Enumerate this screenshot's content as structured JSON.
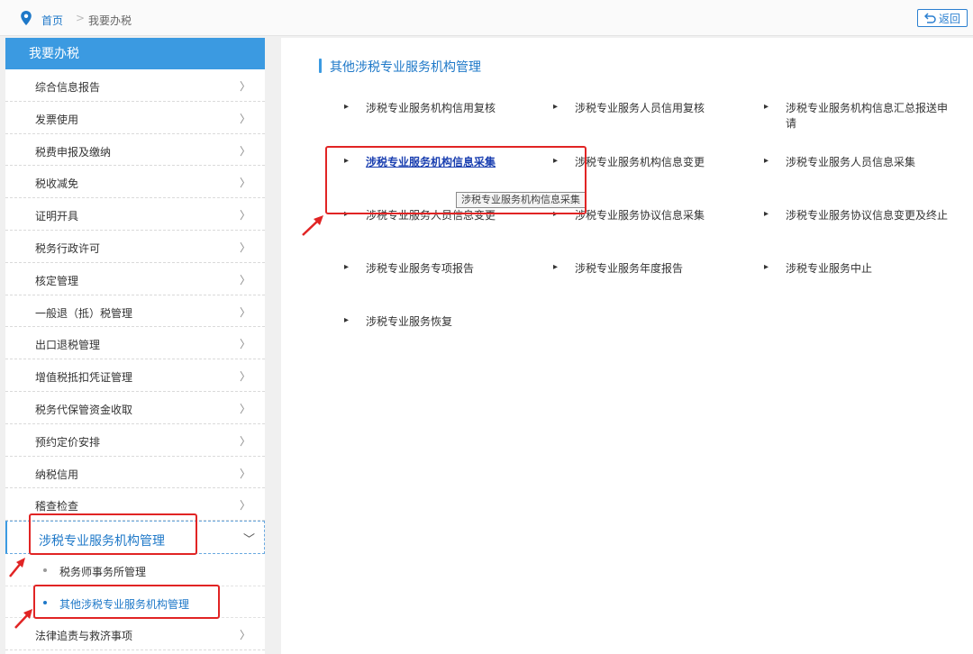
{
  "breadcrumb": {
    "home": "首页",
    "separator": ">",
    "current": "我要办税",
    "back_label": "返回"
  },
  "sidebar": {
    "header": "我要办税",
    "items": [
      {
        "label": "综合信息报告",
        "chevron": "〉"
      },
      {
        "label": "发票使用",
        "chevron": "〉"
      },
      {
        "label": "税费申报及缴纳",
        "chevron": "〉"
      },
      {
        "label": "税收减免",
        "chevron": "〉"
      },
      {
        "label": "证明开具",
        "chevron": "〉"
      },
      {
        "label": "税务行政许可",
        "chevron": "〉"
      },
      {
        "label": "核定管理",
        "chevron": "〉"
      },
      {
        "label": "一般退（抵）税管理",
        "chevron": "〉"
      },
      {
        "label": "出口退税管理",
        "chevron": "〉"
      },
      {
        "label": "增值税抵扣凭证管理",
        "chevron": "〉"
      },
      {
        "label": "税务代保管资金收取",
        "chevron": "〉"
      },
      {
        "label": "预约定价安排",
        "chevron": "〉"
      },
      {
        "label": "纳税信用",
        "chevron": "〉"
      },
      {
        "label": "稽查检查",
        "chevron": "〉"
      }
    ],
    "active_item": {
      "label": "涉税专业服务机构管理",
      "chevron": "﹀"
    },
    "sub_items": [
      {
        "label": "税务师事务所管理"
      },
      {
        "label": "其他涉税专业服务机构管理"
      }
    ],
    "after_item": {
      "label": "法律追责与救济事项",
      "chevron": "〉"
    }
  },
  "main": {
    "section_title": "其他涉税专业服务机构管理",
    "links": [
      "涉税专业服务机构信用复核",
      "涉税专业服务人员信用复核",
      "涉税专业服务机构信息汇总报送申请",
      "涉税专业服务机构信息采集",
      "涉税专业服务机构信息变更",
      "涉税专业服务人员信息采集",
      "涉税专业服务人员信息变更",
      "涉税专业服务协议信息采集",
      "涉税专业服务协议信息变更及终止",
      "涉税专业服务专项报告",
      "涉税专业服务年度报告",
      "涉税专业服务中止",
      "涉税专业服务恢复"
    ],
    "link_arrow": "▸",
    "tooltip": "涉税专业服务机构信息采集"
  },
  "colors": {
    "accent": "#3b9ae1",
    "link_active": "#1e78c8",
    "annotation_red": "#e12424"
  }
}
